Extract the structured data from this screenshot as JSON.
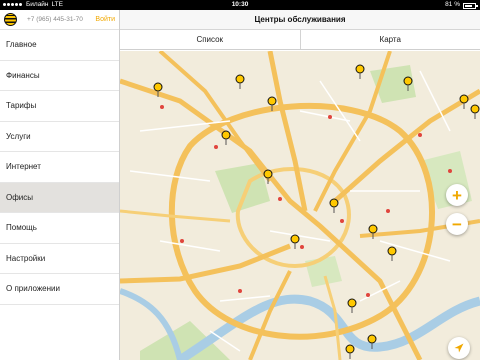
{
  "statusbar": {
    "carrier": "Билайн",
    "network": "LTE",
    "time": "10:30",
    "battery": "81 %",
    "battery_level": 0.81
  },
  "sidebar": {
    "phone": "+7 (965) 445-31-70",
    "login_label": "Войти",
    "items": [
      {
        "label": "Главное"
      },
      {
        "label": "Финансы"
      },
      {
        "label": "Тарифы"
      },
      {
        "label": "Услуги"
      },
      {
        "label": "Интернет"
      },
      {
        "label": "Офисы",
        "active": true
      },
      {
        "label": "Помощь"
      },
      {
        "label": "Настройки"
      },
      {
        "label": "О приложении"
      }
    ]
  },
  "header": {
    "title": "Центры обслуживания"
  },
  "segments": {
    "list_label": "Список",
    "map_label": "Карта"
  },
  "map": {
    "zoom_in": "+",
    "zoom_out": "−",
    "colors": {
      "accent": "#ffc800",
      "road": "#f4c15b",
      "park": "#cfe3b3",
      "water": "#a9cde5"
    }
  }
}
